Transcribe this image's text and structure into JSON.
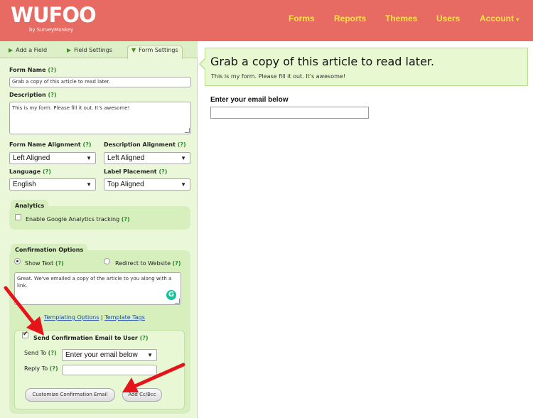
{
  "app": {
    "logo": "WUFOO",
    "logo_sub": "by SurveyMonkey"
  },
  "nav": {
    "items": [
      "Forms",
      "Reports",
      "Themes",
      "Users"
    ],
    "account": "Account"
  },
  "tabs": [
    "Add a Field",
    "Field Settings",
    "Form Settings"
  ],
  "help": "(?)",
  "form_name": {
    "label": "Form Name",
    "value": "Grab a copy of this article to read later."
  },
  "description": {
    "label": "Description",
    "value": "This is my form. Please fill it out. It's awesome!"
  },
  "form_name_alignment": {
    "label": "Form Name Alignment",
    "value": "Left Aligned"
  },
  "description_alignment": {
    "label": "Description Alignment",
    "value": "Left Aligned"
  },
  "language": {
    "label": "Language",
    "value": "English"
  },
  "label_placement": {
    "label": "Label Placement",
    "value": "Top Aligned"
  },
  "analytics": {
    "title": "Analytics",
    "checkbox_label": "Enable Google Analytics tracking"
  },
  "confirmation": {
    "title": "Confirmation Options",
    "show_text": "Show Text",
    "redirect": "Redirect to Website",
    "message": "Great. We've emailed a copy of the article to you along with a link.",
    "templating_options": "Templating Options",
    "separator": "|",
    "template_tags": "Template Tags",
    "send_email_label": "Send Confirmation Email to User",
    "send_to_label": "Send To",
    "send_to_value": "Enter your email below",
    "reply_to_label": "Reply To",
    "customize_button": "Customize Confirmation Email",
    "add_cc_button": "Add Cc/Bcc"
  },
  "preview": {
    "title": "Grab a copy of this article to read later.",
    "description": "This is my form. Please fill it out. It's awesome!",
    "field_label": "Enter your email below"
  },
  "colors": {
    "header": "#e76a63",
    "nav_text": "#ffe24a",
    "panel": "#eaf7d9",
    "box": "#d7efbd",
    "arrow": "#e5141a"
  }
}
